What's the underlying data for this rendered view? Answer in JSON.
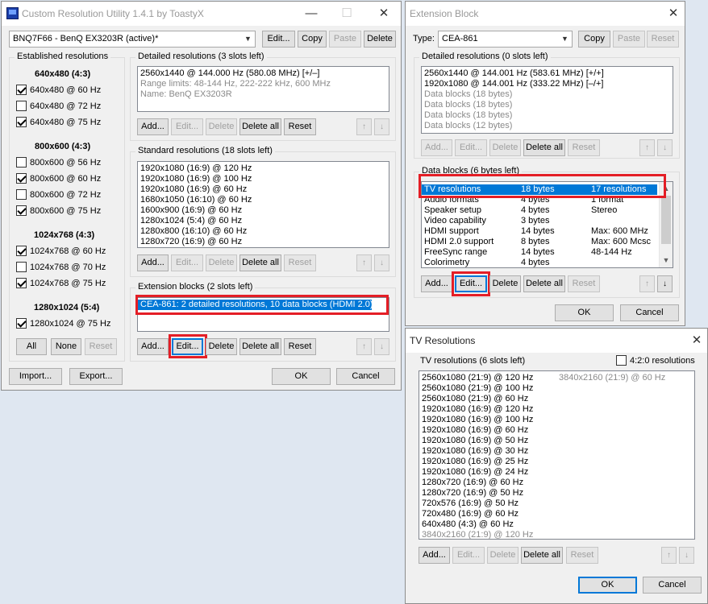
{
  "cru": {
    "title": "Custom Resolution Utility 1.4.1 by ToastyX",
    "monitor": "BNQ7F66 - BenQ EX3203R (active)*",
    "top_buttons": [
      "Edit...",
      "Copy",
      "Paste",
      "Delete"
    ],
    "established": {
      "label": "Established resolutions",
      "groups": [
        {
          "header": "640x480 (4:3)",
          "items": [
            {
              "label": "640x480 @ 60 Hz",
              "checked": true
            },
            {
              "label": "640x480 @ 72 Hz",
              "checked": false
            },
            {
              "label": "640x480 @ 75 Hz",
              "checked": true
            }
          ]
        },
        {
          "header": "800x600 (4:3)",
          "items": [
            {
              "label": "800x600 @ 56 Hz",
              "checked": false
            },
            {
              "label": "800x600 @ 60 Hz",
              "checked": true
            },
            {
              "label": "800x600 @ 72 Hz",
              "checked": false
            },
            {
              "label": "800x600 @ 75 Hz",
              "checked": true
            }
          ]
        },
        {
          "header": "1024x768 (4:3)",
          "items": [
            {
              "label": "1024x768 @ 60 Hz",
              "checked": true
            },
            {
              "label": "1024x768 @ 70 Hz",
              "checked": false
            },
            {
              "label": "1024x768 @ 75 Hz",
              "checked": true
            }
          ]
        },
        {
          "header": "1280x1024 (5:4)",
          "items": [
            {
              "label": "1280x1024 @ 75 Hz",
              "checked": true
            }
          ]
        }
      ],
      "buttons": [
        "All",
        "None",
        "Reset"
      ]
    },
    "detailed": {
      "label": "Detailed resolutions (3 slots left)",
      "lines": [
        "2560x1440 @ 144.000 Hz (580.08 MHz) [+/–]",
        "Range limits: 48-144 Hz, 222-222 kHz, 600 MHz",
        "Name: BenQ EX3203R"
      ]
    },
    "standard": {
      "label": "Standard resolutions (18 slots left)",
      "lines": [
        "1920x1080 (16:9) @ 120 Hz",
        "1920x1080 (16:9) @ 100 Hz",
        "1920x1080 (16:9) @ 60 Hz",
        "1680x1050 (16:10) @ 60 Hz",
        "1600x900 (16:9) @ 60 Hz",
        "1280x1024 (5:4) @ 60 Hz",
        "1280x800 (16:10) @ 60 Hz",
        "1280x720 (16:9) @ 60 Hz"
      ]
    },
    "extension": {
      "label": "Extension blocks (2 slots left)",
      "lines": [
        "CEA-861: 2 detailed resolutions, 10 data blocks (HDMI 2.0)"
      ]
    },
    "list_buttons": [
      "Add...",
      "Edit...",
      "Delete",
      "Delete all",
      "Reset"
    ],
    "arrows": [
      "↑",
      "↓"
    ],
    "import": "Import...",
    "export": "Export...",
    "ok": "OK",
    "cancel": "Cancel"
  },
  "ext": {
    "title": "Extension Block",
    "type_label": "Type:",
    "type_value": "CEA-861",
    "type_buttons": [
      "Copy",
      "Paste",
      "Reset"
    ],
    "detailed": {
      "label": "Detailed resolutions (0 slots left)",
      "lines": [
        "2560x1440 @ 144.001 Hz (583.61 MHz) [+/+]",
        "1920x1080 @ 144.001 Hz (333.22 MHz) [–/+]",
        "Data blocks (18 bytes)",
        "Data blocks (18 bytes)",
        "Data blocks (18 bytes)",
        "Data blocks (12 bytes)"
      ]
    },
    "datablocks": {
      "label": "Data blocks (6 bytes left)",
      "rows": [
        {
          "name": "TV resolutions",
          "size": "18 bytes",
          "info": "17 resolutions"
        },
        {
          "name": "Audio formats",
          "size": "4 bytes",
          "info": "1 format"
        },
        {
          "name": "Speaker setup",
          "size": "4 bytes",
          "info": "Stereo"
        },
        {
          "name": "Video capability",
          "size": "3 bytes",
          "info": ""
        },
        {
          "name": "HDMI support",
          "size": "14 bytes",
          "info": "Max: 600 MHz"
        },
        {
          "name": "HDMI 2.0 support",
          "size": "8 bytes",
          "info": "Max: 600 Mcsc"
        },
        {
          "name": "FreeSync range",
          "size": "14 bytes",
          "info": "48-144 Hz"
        },
        {
          "name": "Colorimetry",
          "size": "4 bytes",
          "info": ""
        }
      ]
    },
    "ok": "OK",
    "cancel": "Cancel"
  },
  "tv": {
    "title": "TV Resolutions",
    "list_label": "TV resolutions (6 slots left)",
    "checkbox_420": "4:2:0 resolutions",
    "col1": [
      "2560x1080 (21:9) @ 120 Hz",
      "2560x1080 (21:9) @ 100 Hz",
      "2560x1080 (21:9) @ 60 Hz",
      "1920x1080 (16:9) @ 120 Hz",
      "1920x1080 (16:9) @ 100 Hz",
      "1920x1080 (16:9) @ 60 Hz",
      "1920x1080 (16:9) @ 50 Hz",
      "1920x1080 (16:9) @ 30 Hz",
      "1920x1080 (16:9) @ 25 Hz",
      "1920x1080 (16:9) @ 24 Hz",
      "1280x720 (16:9) @ 60 Hz",
      "1280x720 (16:9) @ 50 Hz",
      "720x576 (16:9) @ 50 Hz",
      "720x480 (16:9) @ 60 Hz",
      "640x480 (4:3) @ 60 Hz",
      "3840x2160 (21:9) @ 120 Hz"
    ],
    "col2": [
      "3840x2160 (21:9) @ 60 Hz"
    ],
    "ok": "OK",
    "cancel": "Cancel"
  },
  "colors": {
    "accent": "#0078d7",
    "highlight": "#e41e26"
  }
}
